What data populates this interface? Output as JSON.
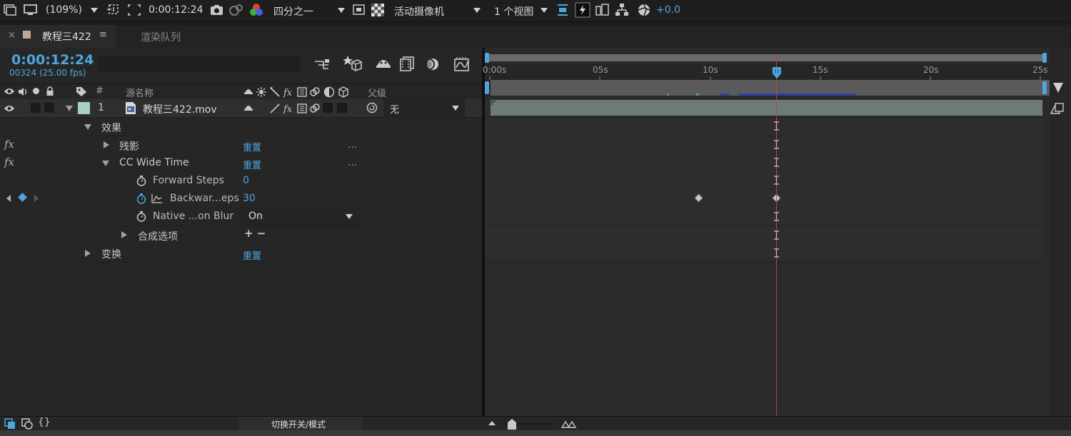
{
  "toolbar": {
    "zoom": "(109%)",
    "timecode": "0:00:12:24",
    "resolution": "四分之一",
    "camera": "活动摄像机",
    "views": "1 个视图",
    "exposure": "+0.0"
  },
  "tabs": {
    "composition": "教程三422",
    "menu_icon": "≡",
    "render_queue": "渲染队列"
  },
  "panel": {
    "current_time": "0:00:12:24",
    "frame_info": "00324 (25.00 fps)",
    "search_placeholder": ""
  },
  "columns": {
    "number": "#",
    "source_name": "源名称",
    "parent": "父级"
  },
  "layer": {
    "number": "1",
    "name": "教程三422.mov",
    "parent_value": "无"
  },
  "properties": {
    "effects": "效果",
    "effect1_name": "残影",
    "effect1_reset": "重置",
    "effect1_more": "...",
    "effect2_name": "CC Wide Time",
    "effect2_reset": "重置",
    "effect2_more": "...",
    "forward_steps_label": "Forward Steps",
    "forward_steps_value": "0",
    "backward_steps_label": "Backwar...eps",
    "backward_steps_value": "30",
    "motion_blur_label": "Native ...on Blur",
    "motion_blur_value": "On",
    "composite_options": "合成选项",
    "composite_plus_minus": "+ −",
    "transform": "变换",
    "transform_reset": "重置",
    "fx_label": "fx"
  },
  "ruler": {
    "labels": [
      "0:00s",
      "05s",
      "10s",
      "15s",
      "20s",
      "25s"
    ]
  },
  "bottom": {
    "toggle_modes": "切换开关/模式"
  },
  "colors": {
    "accent_blue": "#4ea6e0",
    "playhead_red": "#d03a3a",
    "layer_bar": "#6d7a78",
    "layer_label": "#a8d0c8"
  },
  "icons": [
    "eye-icon",
    "audio-icon",
    "solo-icon",
    "lock-icon",
    "label-icon",
    "stopwatch-icon",
    "keyframe-icon",
    "graph-icon",
    "fx-icon",
    "camera-icon"
  ]
}
